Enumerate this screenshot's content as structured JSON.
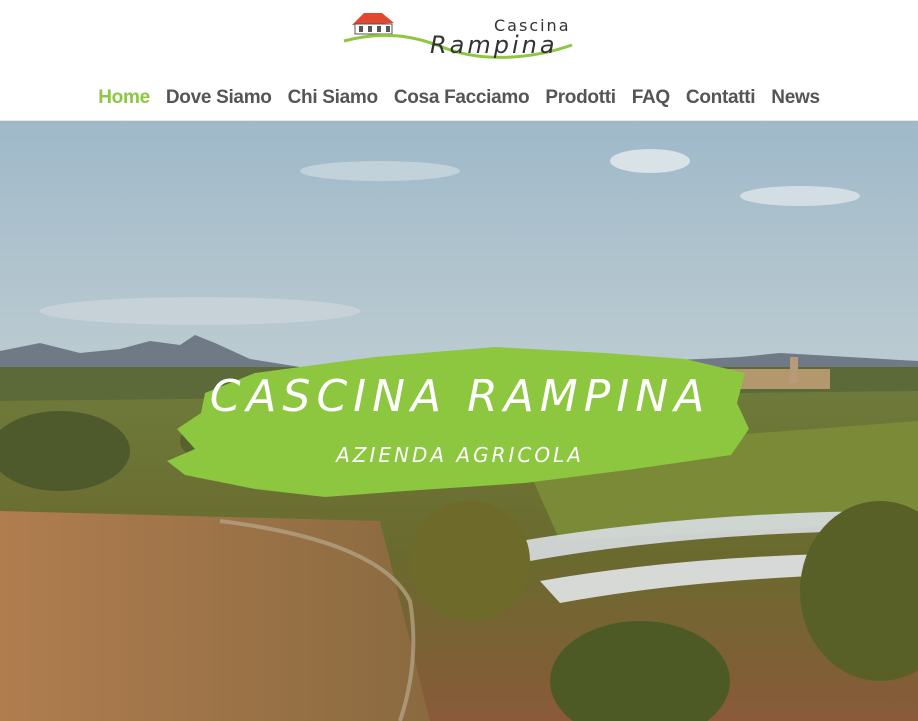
{
  "brand": {
    "logo_top": "Cascina",
    "logo_main": "Rampina"
  },
  "nav": {
    "items": [
      {
        "label": "Home",
        "active": true
      },
      {
        "label": "Dove Siamo",
        "active": false
      },
      {
        "label": "Chi Siamo",
        "active": false
      },
      {
        "label": "Cosa Facciamo",
        "active": false
      },
      {
        "label": "Prodotti",
        "active": false
      },
      {
        "label": "FAQ",
        "active": false
      },
      {
        "label": "Contatti",
        "active": false
      },
      {
        "label": "News",
        "active": false
      }
    ]
  },
  "hero": {
    "title": "Cascina Rampina",
    "subtitle": "Azienda Agricola"
  },
  "colors": {
    "accent": "#8dc63f",
    "nav_text": "#555555",
    "logo_red": "#e2472f"
  }
}
